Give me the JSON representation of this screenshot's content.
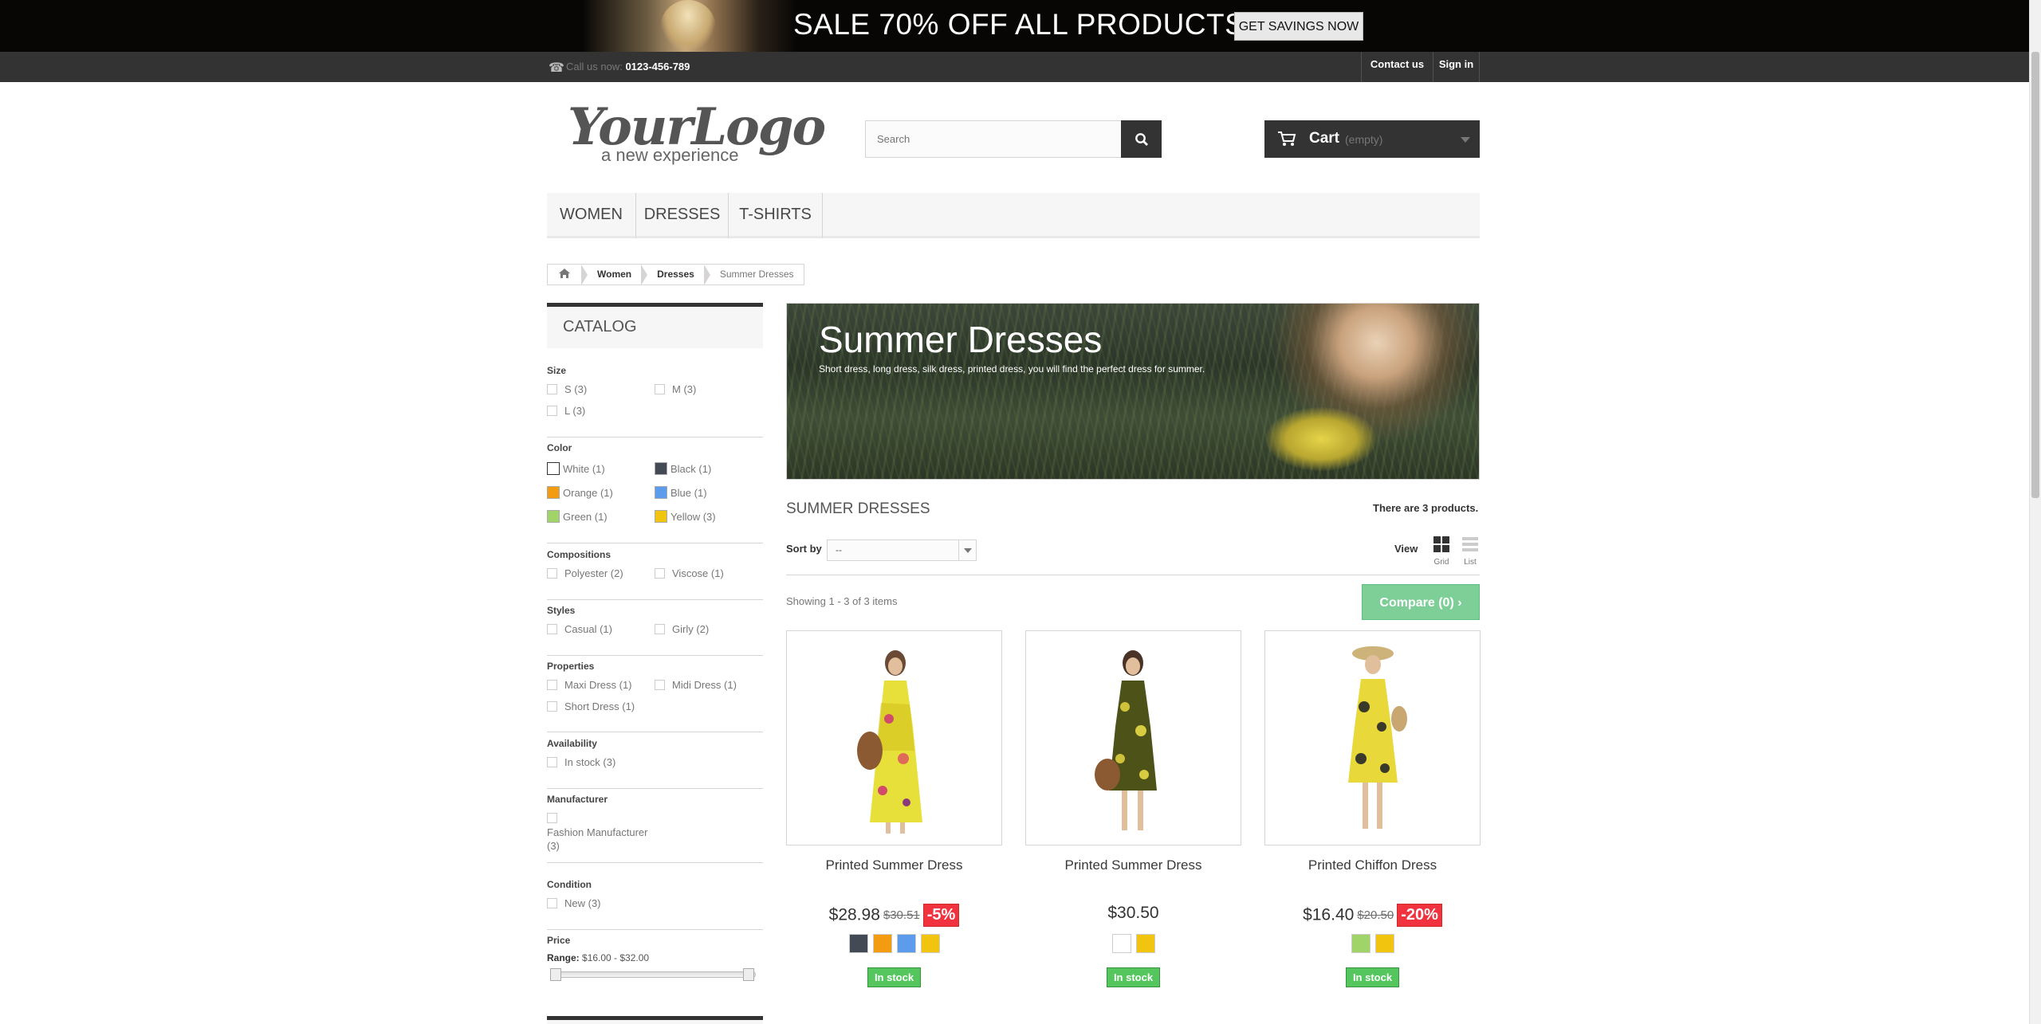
{
  "promo": {
    "message": "SALE 70% OFF ALL PRODUCTS",
    "button": "GET SAVINGS NOW"
  },
  "topbar": {
    "call_label": "Call us now:",
    "phone": "0123-456-789",
    "contact": "Contact us",
    "signin": "Sign in"
  },
  "logo": {
    "brand": "YourLogo",
    "tagline": "a new experience"
  },
  "search": {
    "placeholder": "Search"
  },
  "cart": {
    "label": "Cart",
    "state": "(empty)"
  },
  "menu": [
    "WOMEN",
    "DRESSES",
    "T-SHIRTS"
  ],
  "breadcrumb": [
    "Women",
    "Dresses",
    "Summer Dresses"
  ],
  "catalog": {
    "title": "CATALOG",
    "size": {
      "title": "Size",
      "options": [
        "S (3)",
        "M (3)",
        "L (3)"
      ]
    },
    "color": {
      "title": "Color",
      "options": [
        {
          "label": "White (1)",
          "color": "#ffffff"
        },
        {
          "label": "Black (1)",
          "color": "#434a54"
        },
        {
          "label": "Orange (1)",
          "color": "#f39c11"
        },
        {
          "label": "Blue (1)",
          "color": "#5d9cec"
        },
        {
          "label": "Green (1)",
          "color": "#a0d468"
        },
        {
          "label": "Yellow (3)",
          "color": "#f1c40f"
        }
      ]
    },
    "compositions": {
      "title": "Compositions",
      "options": [
        "Polyester (2)",
        "Viscose (1)"
      ]
    },
    "styles": {
      "title": "Styles",
      "options": [
        "Casual (1)",
        "Girly (2)"
      ]
    },
    "properties": {
      "title": "Properties",
      "options": [
        "Maxi Dress (1)",
        "Midi Dress (1)",
        "Short Dress (1)"
      ]
    },
    "availability": {
      "title": "Availability",
      "options": [
        "In stock (3)"
      ]
    },
    "manufacturer": {
      "title": "Manufacturer",
      "line1": "Fashion Manufacturer",
      "line2": "(3)"
    },
    "condition": {
      "title": "Condition",
      "options": [
        "New (3)"
      ]
    },
    "price": {
      "title": "Price",
      "range_label": "Range:",
      "range_value": "$16.00 - $32.00"
    }
  },
  "category": {
    "title": "Summer Dresses",
    "description": "Short dress, long dress, silk dress, printed dress, you will find the perfect dress for summer."
  },
  "listing": {
    "heading": "SUMMER DRESSES",
    "count": "There are 3 products.",
    "sort_label": "Sort by",
    "sort_value": "--",
    "view_label": "View",
    "grid": "Grid",
    "list": "List",
    "showing": "Showing 1 - 3 of 3 items",
    "compare": "Compare (0)"
  },
  "products": [
    {
      "name": "Printed Summer Dress",
      "price": "$28.98",
      "old": "$30.51",
      "discount": "-5%",
      "colors": [
        "#434a54",
        "#f39c11",
        "#5d9cec",
        "#f1c40f"
      ],
      "stock": "In stock"
    },
    {
      "name": "Printed Summer Dress",
      "price": "$30.50",
      "old": "",
      "discount": "",
      "colors": [
        "#ffffff",
        "#f1c40f"
      ],
      "stock": "In stock"
    },
    {
      "name": "Printed Chiffon Dress",
      "price": "$16.40",
      "old": "$20.50",
      "discount": "-20%",
      "colors": [
        "#a0d468",
        "#f1c40f"
      ],
      "stock": "In stock"
    }
  ]
}
